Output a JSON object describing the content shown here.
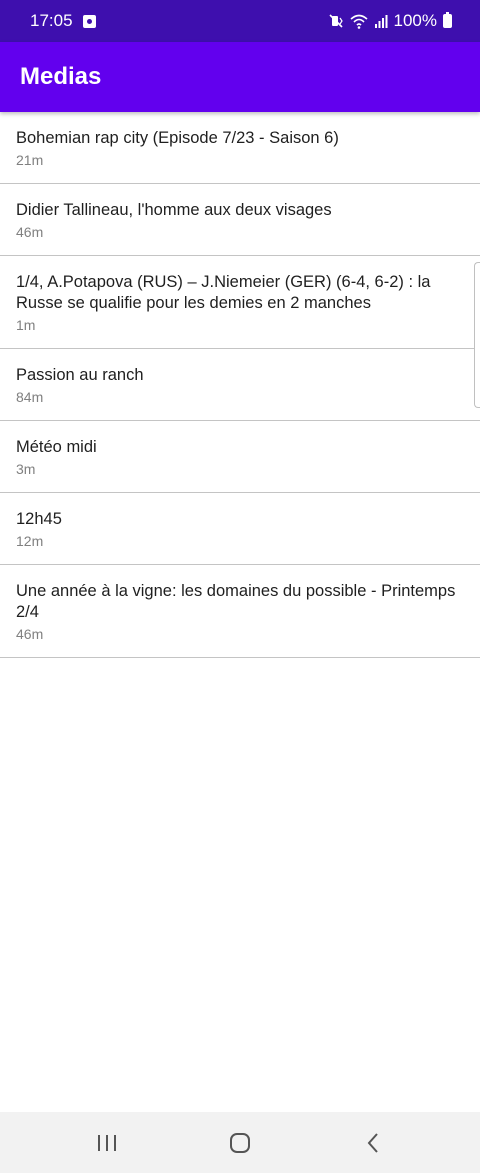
{
  "status_bar": {
    "time": "17:05",
    "battery": "100%",
    "colors": {
      "background": "#3e0fae",
      "text": "#ffffff"
    },
    "icons": [
      "notification-app-icon",
      "mute-vibrate-icon",
      "wifi-icon",
      "signal-icon",
      "battery-icon"
    ]
  },
  "app_bar": {
    "title": "Medias",
    "background": "#6200ee"
  },
  "media_items": [
    {
      "title": "Bohemian rap city (Episode 7/23 - Saison 6)",
      "duration": "21m"
    },
    {
      "title": "Didier Tallineau, l'homme aux deux visages",
      "duration": "46m"
    },
    {
      "title": "1/4, A.Potapova (RUS) – J.Niemeier (GER) (6-4, 6-2) : la Russe se qualifie pour les demies en 2 manches",
      "duration": "1m"
    },
    {
      "title": "Passion au ranch",
      "duration": "84m"
    },
    {
      "title": "Météo midi",
      "duration": "3m"
    },
    {
      "title": "12h45",
      "duration": "12m"
    },
    {
      "title": "Une année à la vigne: les domaines du possible - Printemps 2/4",
      "duration": "46m"
    }
  ],
  "nav_bar": {
    "buttons": [
      "recent-apps-icon",
      "home-icon",
      "back-icon"
    ]
  }
}
